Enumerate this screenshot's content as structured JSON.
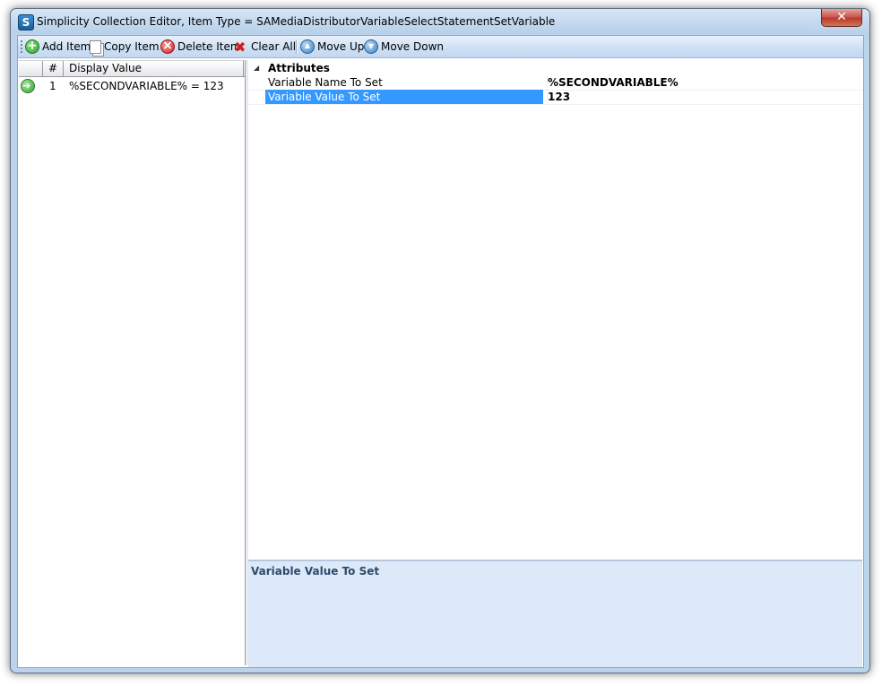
{
  "window": {
    "title": "Simplicity Collection Editor, Item Type = SAMediaDistributorVariableSelectStatementSetVariable",
    "app_icon_letter": "S",
    "close_glyph": "✕"
  },
  "toolbar": {
    "add_label": "Add Item",
    "copy_label": "Copy Item",
    "delete_label": "Delete Item",
    "clear_label": "Clear All",
    "move_up_label": "Move Up",
    "move_down_label": "Move Down"
  },
  "item_list": {
    "columns": [
      "#",
      "Display Value"
    ],
    "rows": [
      {
        "index": "1",
        "display_value": "%SECONDVARIABLE% = 123",
        "icon": "green-arrow-icon"
      }
    ]
  },
  "property_grid": {
    "category": "Attributes",
    "properties": [
      {
        "name": "Variable Name To Set",
        "value": "%SECONDVARIABLE%",
        "selected": false
      },
      {
        "name": "Variable Value To Set",
        "value": "123",
        "selected": true
      }
    ]
  },
  "help": {
    "title": "Variable Value To Set"
  },
  "colors": {
    "selection": "#3399ff",
    "help_background": "#dde9f8",
    "toolbar_top": "#e9f2fc",
    "toolbar_bottom": "#c2d7f0"
  }
}
